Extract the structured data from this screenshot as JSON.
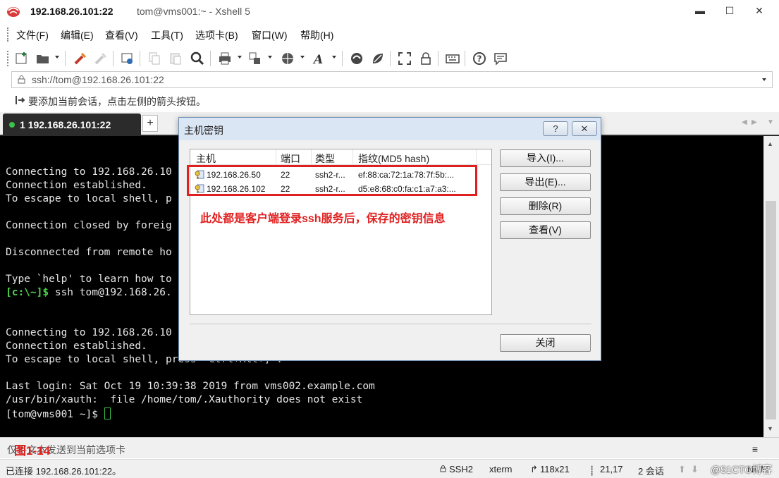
{
  "window": {
    "title_host": "192.168.26.101:22",
    "title_rest": "tom@vms001:~ - Xshell 5",
    "minimize": "▬",
    "maximize": "☐",
    "close": "✕"
  },
  "menu": [
    "文件(F)",
    "编辑(E)",
    "查看(V)",
    "工具(T)",
    "选项卡(B)",
    "窗口(W)",
    "帮助(H)"
  ],
  "toolbar_icons": [
    "new-session",
    "open",
    "reconnect",
    "disconnect",
    "properties",
    "copy",
    "paste",
    "find",
    "print",
    "transfer",
    "globe",
    "font",
    "xftp",
    "xagent",
    "fullscreen",
    "lock",
    "keyboard",
    "help",
    "chat"
  ],
  "address": {
    "lock_glyph": "🔒",
    "text": "ssh://tom@192.168.26.101:22"
  },
  "hint": {
    "text": "要添加当前会话，点击左侧的箭头按钮。"
  },
  "tabs": {
    "active_label": "1 192.168.26.101:22",
    "add_label": "+"
  },
  "terminal": {
    "lines": [
      "",
      "Connecting to 192.168.26.10",
      "Connection established.",
      "To escape to local shell, p",
      "",
      "Connection closed by foreig",
      "",
      "Disconnected from remote ho",
      "",
      "Type `help' to learn how to",
      "",
      "",
      "",
      "Connecting to 192.168.26.10",
      "Connection established.",
      "To escape to local shell, press  Ctrl+Alt+] .",
      "",
      "Last login: Sat Oct 19 10:39:38 2019 from vms002.example.com",
      "/usr/bin/xauth:  file /home/tom/.Xauthority does not exist",
      "[tom@vms001 ~]$ "
    ],
    "local_prompt": "[c:\\~]$",
    "local_command": " ssh tom@192.168.26."
  },
  "sendbar": {
    "text": "仅将文本发送到当前选项卡",
    "figure_label": "图1-14",
    "menu_glyph": "≡"
  },
  "status": {
    "connected": "已连接 192.168.26.101:22。",
    "protocol": "SSH2",
    "term": "xterm",
    "size": "118x21",
    "position": "21,17",
    "sessions": "2 会话",
    "caps": "NUM",
    "watermark": "@51CTO博客"
  },
  "dialog": {
    "title": "主机密钥",
    "help": "?",
    "close": "✕",
    "columns": [
      "主机",
      "端口",
      "类型",
      "指纹(MD5 hash)"
    ],
    "rows": [
      {
        "host": "192.168.26.50",
        "port": "22",
        "type": "ssh2-r...",
        "fingerprint": "ef:88:ca:72:1a:78:7f:5b:..."
      },
      {
        "host": "192.168.26.102",
        "port": "22",
        "type": "ssh2-r...",
        "fingerprint": "d5:e8:68:c0:fa:c1:a7:a3:..."
      }
    ],
    "annotation": "此处都是客户端登录ssh服务后，保存的密钥信息",
    "buttons": {
      "import": "导入(I)...",
      "export": "导出(E)...",
      "delete": "删除(R)",
      "view": "查看(V)",
      "close": "关闭"
    }
  },
  "colors": {
    "terminal_bg": "#000000",
    "annotation": "#e02020",
    "prompt_green": "#4dd34d",
    "tab_active": "#2b2b2b"
  }
}
